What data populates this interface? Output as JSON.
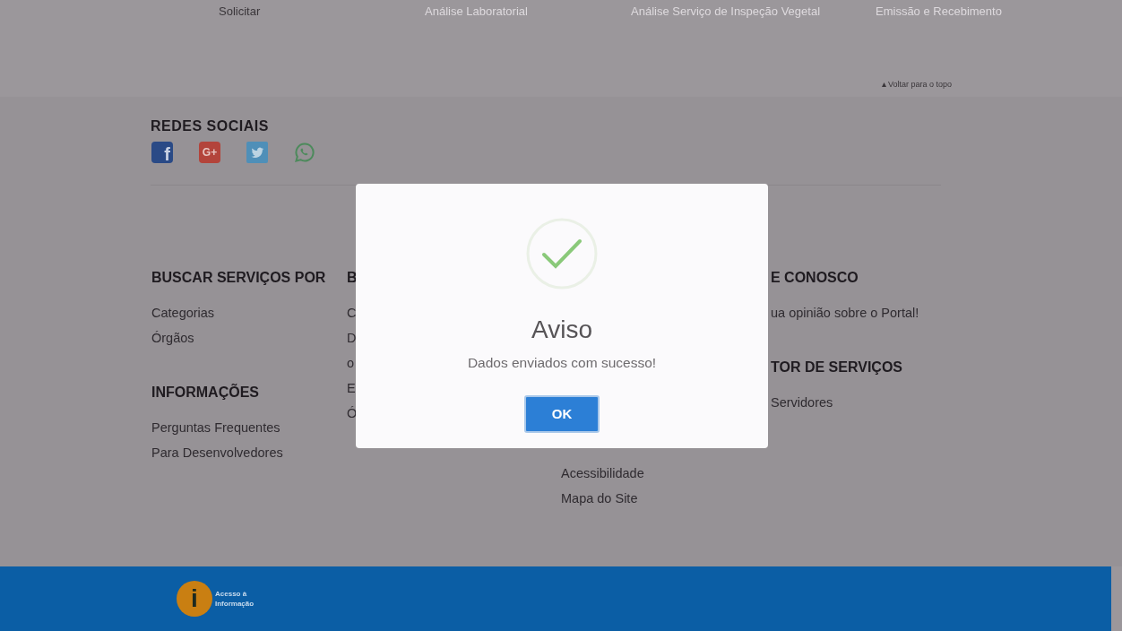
{
  "top_nav": {
    "items": [
      {
        "label": "Solicitar",
        "selected": true
      },
      {
        "label": "Análise Laboratorial",
        "selected": false
      },
      {
        "label": "Análise Serviço de Inspeção Vegetal",
        "selected": false
      },
      {
        "label": "Emissão e Recebimento",
        "selected": false
      }
    ]
  },
  "back_to_top": "Voltar para o topo",
  "social": {
    "title": "REDES SOCIAIS",
    "icons": [
      {
        "kind": "facebook",
        "glyph": "f"
      },
      {
        "kind": "googleplus",
        "glyph": "G+"
      },
      {
        "kind": "twitter"
      },
      {
        "kind": "whatsapp"
      }
    ]
  },
  "columns": [
    {
      "groups": [
        {
          "heading": "BUSCAR SERVIÇOS POR",
          "links": [
            "Categorias",
            "Órgãos"
          ]
        },
        {
          "heading": "INFORMAÇÕES",
          "links": [
            "Perguntas Frequentes",
            "Para Desenvolvedores"
          ]
        }
      ]
    },
    {
      "groups": [
        {
          "heading": "B",
          "links": [
            "C",
            "D",
            "o",
            "E",
            "Ó"
          ]
        }
      ]
    },
    {
      "groups": [
        {
          "links": [
            "Acessibilidade",
            "Mapa do Site"
          ]
        }
      ]
    },
    {
      "groups": [
        {
          "heading": "E CONOSCO",
          "links": [
            "ua opinião sobre o Portal!"
          ]
        },
        {
          "heading": "TOR DE SERVIÇOS",
          "links": [
            "Servidores"
          ]
        }
      ]
    }
  ],
  "footer": {
    "logo_glyph": "i",
    "logo_lines": [
      "Acesso à",
      "Informação"
    ]
  },
  "dialog": {
    "title": "Aviso",
    "message": "Dados enviados com sucesso!",
    "button": "OK"
  }
}
